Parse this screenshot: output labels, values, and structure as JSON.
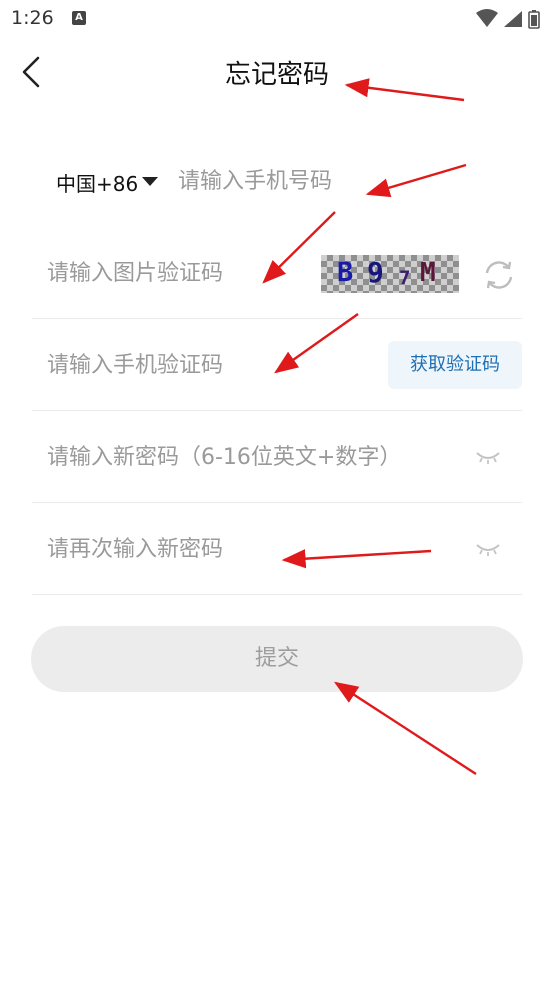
{
  "status_bar": {
    "time": "1:26",
    "notification_letter": "A"
  },
  "header": {
    "title": "忘记密码"
  },
  "phone": {
    "country_code": "中国+86",
    "placeholder": "请输入手机号码"
  },
  "image_captcha": {
    "placeholder": "请输入图片验证码",
    "chars": [
      "B",
      "9",
      "7",
      "M"
    ]
  },
  "sms_code": {
    "placeholder": "请输入手机验证码",
    "button_label": "获取验证码"
  },
  "new_password": {
    "placeholder": "请输入新密码（6-16位英文+数字）"
  },
  "confirm_password": {
    "placeholder": "请再次输入新密码"
  },
  "submit": {
    "label": "提交"
  },
  "colors": {
    "accent": "#1e6fb3",
    "annotation_arrow": "#e01a1a",
    "submit_bg": "#ececec"
  },
  "icons": [
    "back-arrow-icon",
    "dropdown-triangle-icon",
    "refresh-icon",
    "eye-closed-icon",
    "wifi-icon",
    "signal-icon",
    "battery-icon"
  ]
}
